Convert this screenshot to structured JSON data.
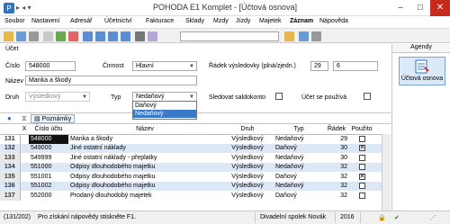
{
  "window": {
    "title": "POHODA E1 Komplet - [Účtová osnova]"
  },
  "menu": [
    "Soubor",
    "Nastavení",
    "Adresář",
    "Účetnictví",
    "Fakturace",
    "Sklady",
    "Mzdy",
    "Jízdy",
    "Majetek",
    "Záznam",
    "Nápověda"
  ],
  "form": {
    "section": "Účet",
    "cislo_label": "Číslo",
    "cislo_value": "548000",
    "cinnost_label": "Činnost",
    "cinnost_value": "Hlavní",
    "radek_label": "Řádek výsledovky (plná/zjedn.)",
    "radek_full": "29",
    "radek_short": "6",
    "nazev_label": "Název",
    "nazev_value": "Manka a škody",
    "druh_label": "Druh",
    "druh_value": "Výsledkový",
    "typ_label": "Typ",
    "typ_value": "Nedaňový",
    "saldo_label": "Sledovat saldokonto",
    "pouziva_label": "Účet se používá",
    "typ_options": [
      "Daňový",
      "Nedaňový"
    ]
  },
  "tabs": {
    "poznamky": "Poznámky"
  },
  "grid": {
    "headers": [
      "X",
      "Číslo účtu",
      "Název",
      "Druh",
      "Typ",
      "Řádek",
      "Použito"
    ],
    "rows": [
      {
        "n": "131",
        "code": "548000",
        "name": "Manka a škody",
        "druh": "Výsledkový",
        "typ": "Nedaňový",
        "radek": "29",
        "used": ""
      },
      {
        "n": "132",
        "code": "549000",
        "name": "Jiné ostatní náklady",
        "druh": "Výsledkový",
        "typ": "Daňový",
        "radek": "30",
        "used": "✕"
      },
      {
        "n": "133",
        "code": "549999",
        "name": "Jiné ostatní náklady - přeplatky",
        "druh": "Výsledkový",
        "typ": "Nedaňový",
        "radek": "30",
        "used": ""
      },
      {
        "n": "134",
        "code": "551000",
        "name": "Odpisy dlouhodobého majetku",
        "druh": "Výsledkový",
        "typ": "Nedaňový",
        "radek": "32",
        "used": ""
      },
      {
        "n": "135",
        "code": "551001",
        "name": "Odpisy dlouhodobého majetku",
        "druh": "Výsledkový",
        "typ": "Daňový",
        "radek": "32",
        "used": "✕"
      },
      {
        "n": "136",
        "code": "551002",
        "name": "Odpisy dlouhodobého majetku",
        "druh": "Výsledkový",
        "typ": "Nedaňový",
        "radek": "32",
        "used": ""
      },
      {
        "n": "137",
        "code": "552000",
        "name": "Prodaný dlouhodobý majetek",
        "druh": "Výsledkový",
        "typ": "Daňový",
        "radek": "32",
        "used": ""
      }
    ]
  },
  "agendy": {
    "header": "Agendy",
    "item": "Účtová osnova"
  },
  "status": {
    "records": "(131/202)",
    "hint": "Pro získání nápovědy stiskněte F1.",
    "company": "Divadelní spolek Novák",
    "year": "2016"
  }
}
